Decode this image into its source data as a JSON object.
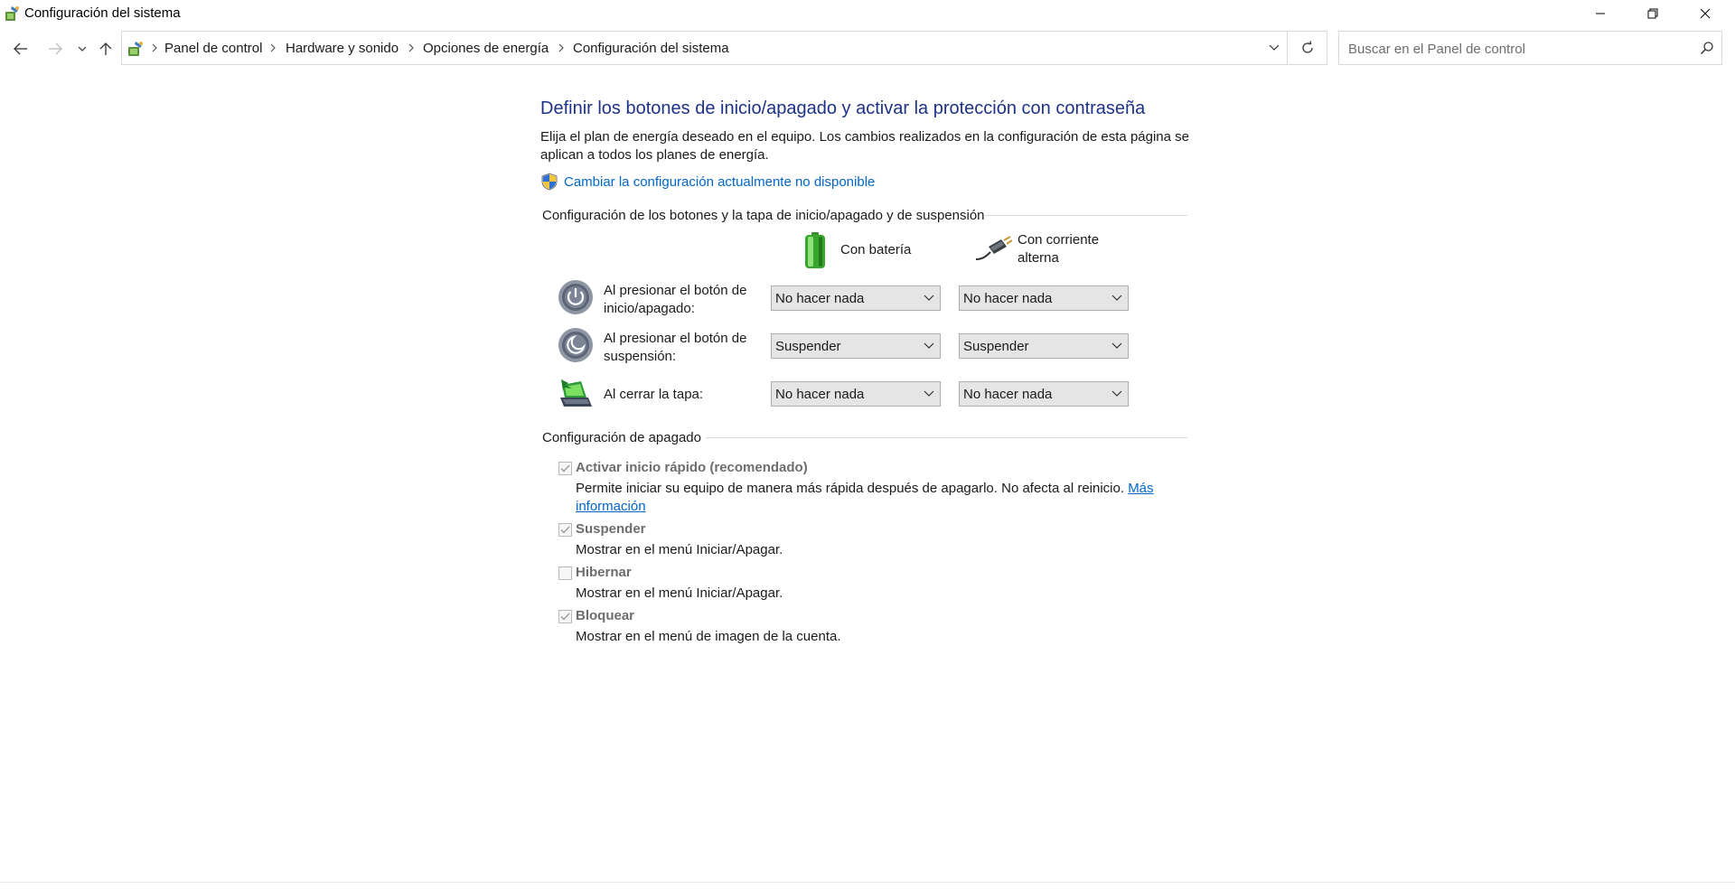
{
  "window": {
    "title": "Configuración del sistema"
  },
  "address_bar": {
    "breadcrumbs": [
      "Panel de control",
      "Hardware y sonido",
      "Opciones de energía",
      "Configuración del sistema"
    ]
  },
  "search": {
    "placeholder": "Buscar en el Panel de control",
    "value": ""
  },
  "page": {
    "title": "Definir los botones de inicio/apagado y activar la protección con contraseña",
    "intro": "Elija el plan de energía deseado en el equipo. Los cambios realizados en la configuración de esta página se aplican a todos los planes de energía.",
    "change_settings_link": "Cambiar la configuración actualmente no disponible"
  },
  "buttons_section": {
    "header": "Configuración de los botones y la tapa de inicio/apagado y de suspensión",
    "col_battery": "Con batería",
    "col_ac": "Con corriente alterna",
    "rows": [
      {
        "label": "Al presionar el botón de inicio/apagado:",
        "battery": "No hacer nada",
        "ac": "No hacer nada",
        "icon": "power-button-icon"
      },
      {
        "label": "Al presionar el botón de suspensión:",
        "battery": "Suspender",
        "ac": "Suspender",
        "icon": "sleep-button-icon"
      },
      {
        "label": "Al cerrar la tapa:",
        "battery": "No hacer nada",
        "ac": "No hacer nada",
        "icon": "laptop-lid-icon"
      }
    ]
  },
  "shutdown_section": {
    "header": "Configuración de apagado",
    "items": [
      {
        "label": "Activar inicio rápido (recomendado)",
        "desc": "Permite iniciar su equipo de manera más rápida después de apagarlo. No afecta al reinicio.",
        "link": "Más información",
        "checked": true
      },
      {
        "label": "Suspender",
        "desc": "Mostrar en el menú Iniciar/Apagar.",
        "checked": true
      },
      {
        "label": "Hibernar",
        "desc": "Mostrar en el menú Iniciar/Apagar.",
        "checked": false
      },
      {
        "label": "Bloquear",
        "desc": "Mostrar en el menú de imagen de la cuenta.",
        "checked": true
      }
    ]
  },
  "colors": {
    "title_blue": "#1e3287",
    "link_blue": "#0066cc",
    "disabled_text": "#6d6d6d"
  }
}
